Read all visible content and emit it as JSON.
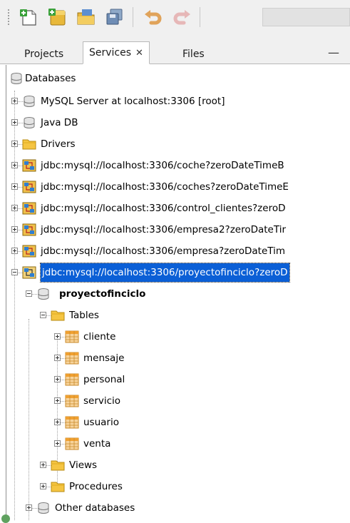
{
  "toolbar": {
    "buttons": [
      {
        "name": "new-file-icon"
      },
      {
        "name": "new-project-icon"
      },
      {
        "name": "open-project-icon"
      },
      {
        "name": "save-all-icon"
      },
      {
        "name": "undo-icon"
      },
      {
        "name": "redo-icon"
      }
    ]
  },
  "tabs": [
    {
      "label": "Projects",
      "active": false
    },
    {
      "label": "Services",
      "active": true
    },
    {
      "label": "Files",
      "active": false
    }
  ],
  "tab_close": "✕",
  "minimize": "—",
  "tree": {
    "root": "Databases",
    "servers": [
      {
        "label": "MySQL Server at localhost:3306 [root]"
      },
      {
        "label": "Java DB"
      }
    ],
    "drivers": "Drivers",
    "connections": [
      "jdbc:mysql://localhost:3306/coche?zeroDateTimeB",
      "jdbc:mysql://localhost:3306/coches?zeroDateTimeE",
      "jdbc:mysql://localhost:3306/control_clientes?zeroD",
      "jdbc:mysql://localhost:3306/empresa2?zeroDateTir",
      "jdbc:mysql://localhost:3306/empresa?zeroDateTim",
      "jdbc:mysql://localhost:3306/proyectofinciclo?zeroD"
    ],
    "schema": "proyectofinciclo",
    "tables_folder": "Tables",
    "tables": [
      "cliente",
      "mensaje",
      "personal",
      "servicio",
      "usuario",
      "venta"
    ],
    "views": "Views",
    "procedures": "Procedures",
    "other": "Other databases"
  },
  "colors": {
    "selection": "#0b5fd6",
    "folder": "#f5c542",
    "table": "#f0a030"
  }
}
